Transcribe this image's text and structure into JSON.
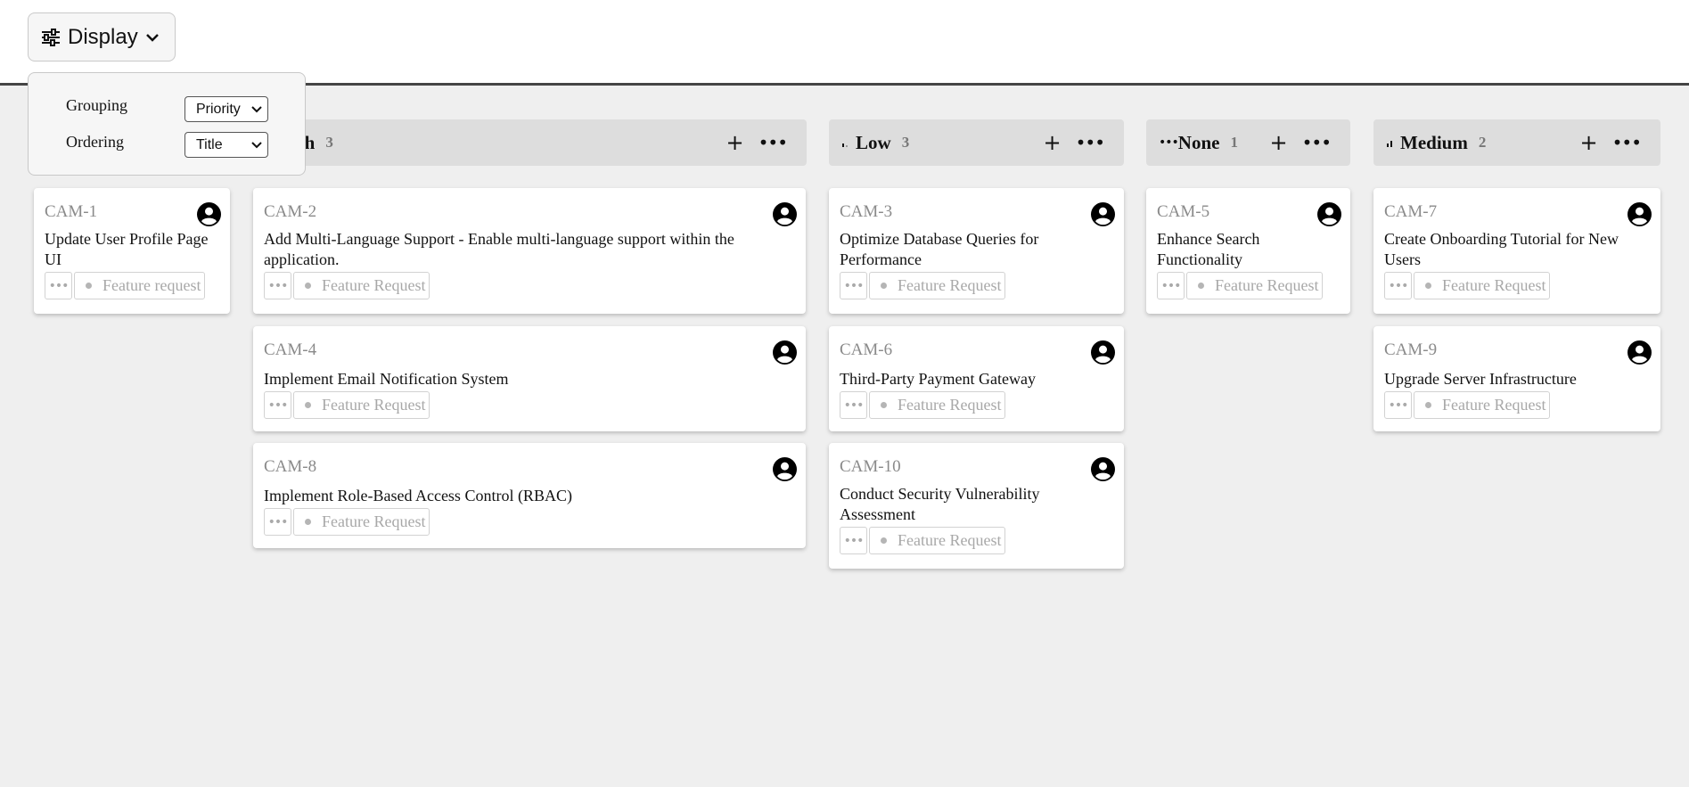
{
  "toolbar": {
    "display_label": "Display"
  },
  "display_menu": {
    "grouping_label": "Grouping",
    "grouping_value": "Priority",
    "ordering_label": "Ordering",
    "ordering_value": "Title"
  },
  "columns": [
    {
      "title": "High",
      "count": "3"
    },
    {
      "title": "Low",
      "count": "3"
    },
    {
      "title": "None",
      "count": "1"
    },
    {
      "title": "Medium",
      "count": "2"
    }
  ],
  "cards": [
    {
      "id": "CAM-1",
      "title": "Update User Profile Page UI",
      "tag": "Feature request"
    },
    {
      "id": "CAM-2",
      "title": "Add Multi-Language Support - Enable multi-language support within the application.",
      "tag": "Feature Request"
    },
    {
      "id": "CAM-4",
      "title": "Implement Email Notification System",
      "tag": "Feature Request"
    },
    {
      "id": "CAM-8",
      "title": "Implement Role-Based Access Control (RBAC)",
      "tag": "Feature Request"
    },
    {
      "id": "CAM-3",
      "title": "Optimize Database Queries for Performance",
      "tag": "Feature Request"
    },
    {
      "id": "CAM-6",
      "title": "Third-Party Payment Gateway",
      "tag": "Feature Request"
    },
    {
      "id": "CAM-10",
      "title": "Conduct Security Vulnerability Assessment",
      "tag": "Feature Request"
    },
    {
      "id": "CAM-5",
      "title": "Enhance Search Functionality",
      "tag": "Feature Request"
    },
    {
      "id": "CAM-7",
      "title": "Create Onboarding Tutorial for New Users",
      "tag": "Feature Request"
    },
    {
      "id": "CAM-9",
      "title": "Upgrade Server Infrastructure",
      "tag": "Feature Request"
    }
  ]
}
